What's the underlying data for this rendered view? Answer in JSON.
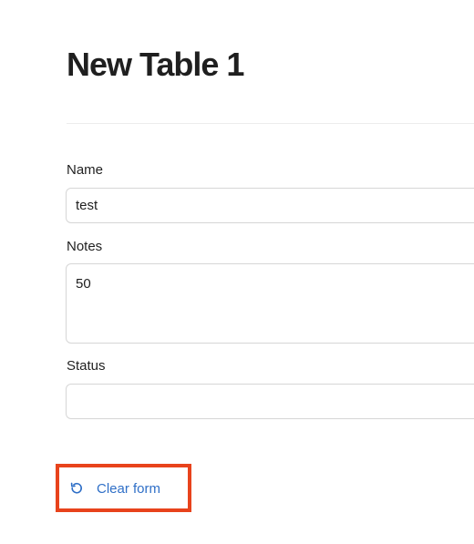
{
  "page": {
    "title": "New Table 1"
  },
  "form": {
    "name": {
      "label": "Name",
      "value": "test"
    },
    "notes": {
      "label": "Notes",
      "value": "50"
    },
    "status": {
      "label": "Status",
      "value": ""
    }
  },
  "actions": {
    "clear_label": "Clear form",
    "clear_icon": "rotate-ccw-icon",
    "accent_color": "#2f6fc7",
    "highlight_color": "#e8431c"
  }
}
